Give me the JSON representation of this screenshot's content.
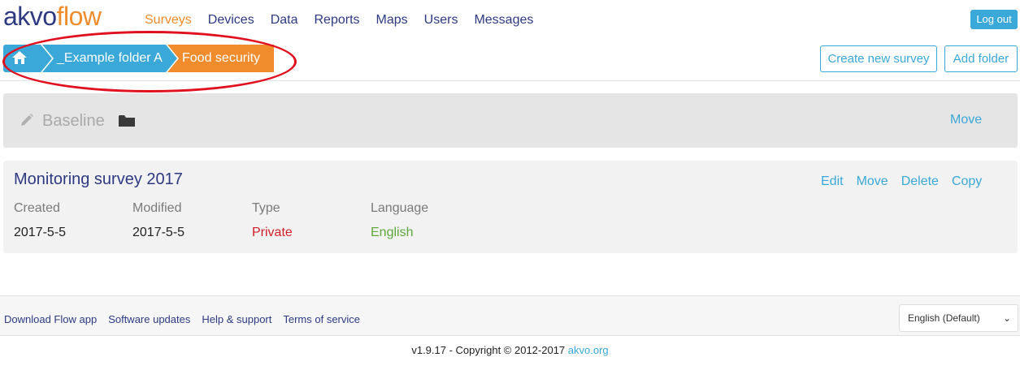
{
  "logo": {
    "part1": "akvo",
    "part2": "flow"
  },
  "nav": {
    "items": [
      "Surveys",
      "Devices",
      "Data",
      "Reports",
      "Maps",
      "Users",
      "Messages"
    ],
    "active": "Surveys"
  },
  "header": {
    "logout_label": "Log out"
  },
  "breadcrumb": {
    "home_icon": "home-icon",
    "folder": "_Example folder A",
    "current": "Food security"
  },
  "toolbar": {
    "create_survey_label": "Create new survey",
    "add_folder_label": "Add folder"
  },
  "folder": {
    "name": "Baseline",
    "move_label": "Move"
  },
  "survey": {
    "title": "Monitoring survey 2017",
    "actions": [
      "Edit",
      "Move",
      "Delete",
      "Copy"
    ],
    "labels": {
      "created": "Created",
      "modified": "Modified",
      "type": "Type",
      "language": "Language"
    },
    "values": {
      "created": "2017-5-5",
      "modified": "2017-5-5",
      "type": "Private",
      "language": "English"
    }
  },
  "footer": {
    "links": [
      "Download Flow app",
      "Software updates",
      "Help & support",
      "Terms of service"
    ],
    "language_select": "English (Default)",
    "copyright_text": "v1.9.17 - Copyright © 2012-2017",
    "copyright_link": "akvo.org"
  },
  "colors": {
    "brand_blue": "#3aa8d8",
    "brand_orange": "#f08c2c",
    "navy": "#2d3a82",
    "annotation_red": "#e0101e"
  }
}
